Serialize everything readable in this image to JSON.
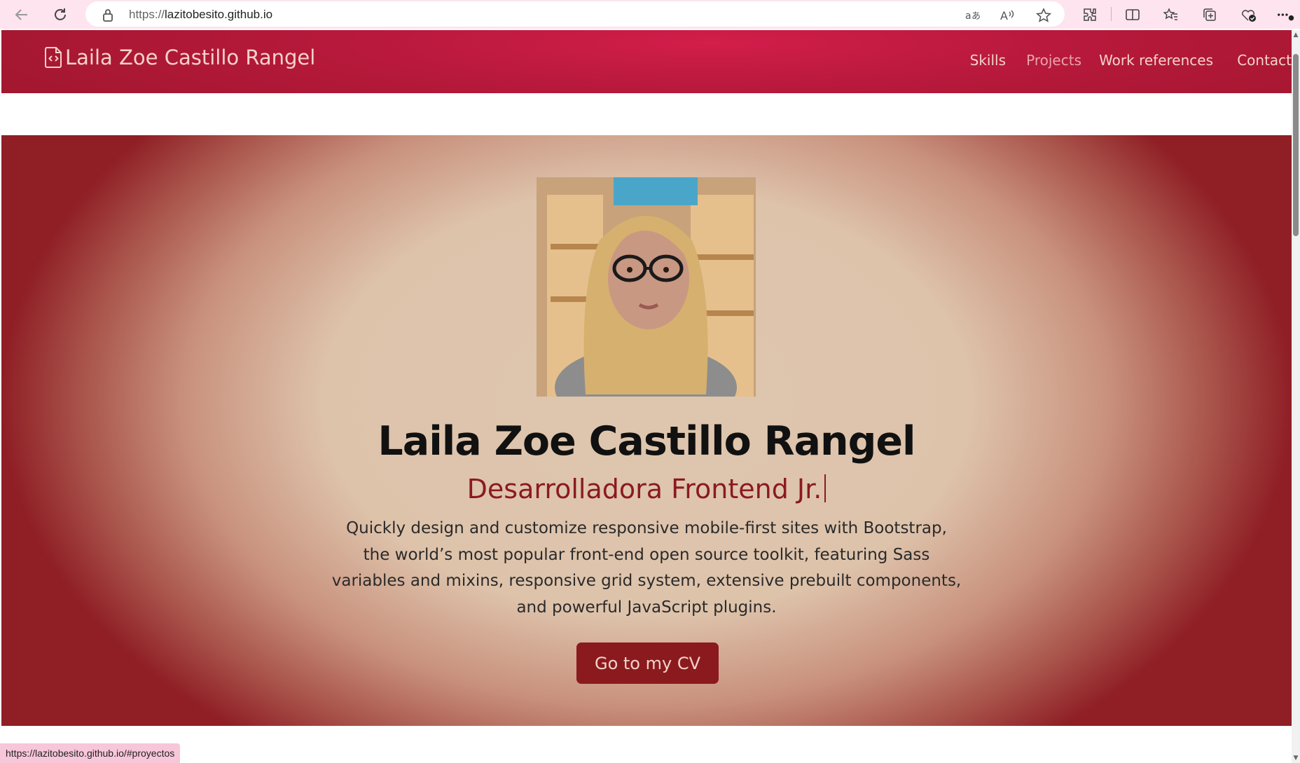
{
  "browser": {
    "url_scheme": "https://",
    "url_host": "lazitobesito.github.io",
    "status_url": "https://lazitobesito.github.io/#proyectos",
    "icons": [
      "back-icon",
      "refresh-icon",
      "lock-icon",
      "translate-icon",
      "read-aloud-icon",
      "favorite-star-icon",
      "extensions-icon",
      "split-screen-icon",
      "favorites-icon",
      "collections-icon",
      "browser-essentials-icon",
      "more-icon"
    ]
  },
  "site": {
    "brand": "Laila Zoe Castillo Rangel",
    "nav": [
      {
        "label": "Skills"
      },
      {
        "label": "Projects"
      },
      {
        "label": "Work references"
      },
      {
        "label": "Contact"
      }
    ]
  },
  "hero": {
    "name": "Laila Zoe Castillo Rangel",
    "role": "Desarrolladora Frontend Jr.",
    "description": "Quickly design and customize responsive mobile-first sites with Bootstrap, the world’s most popular front-end open source toolkit, featuring Sass variables and mixins, responsive grid system, extensive prebuilt components, and powerful JavaScript plugins.",
    "cta_label": "Go to my CV"
  },
  "colors": {
    "navbar": "#b8193c",
    "accent": "#8b1a1f",
    "hero_center": "#dec6ae",
    "nav_text": "#f4d3c9",
    "browser_bar": "#fde4ef"
  }
}
